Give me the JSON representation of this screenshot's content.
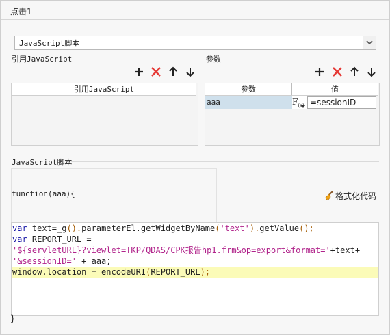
{
  "window": {
    "title": "点击1"
  },
  "script_type": {
    "selected": "JavaScript脚本"
  },
  "ref_js": {
    "group_label": "引用JavaScript",
    "column_header": "引用JavaScript"
  },
  "params": {
    "group_label": "参数",
    "col_name": "参数",
    "col_value": "值",
    "rows": [
      {
        "name": "aaa",
        "fx": "F",
        "fx_sub": "(x)",
        "value": "=sessionID"
      }
    ]
  },
  "script": {
    "group_label": "JavaScript脚本",
    "func_signature": "function(aaa){",
    "format_label": "格式化代码",
    "closing_brace": "}",
    "code": {
      "l1_kw": "var",
      "l1_a": " text=_g",
      "l1_b": "().",
      "l1_c": "parameterEl.getWidgetByName",
      "l1_d": "(",
      "l1_e": "'text'",
      "l1_f": ").",
      "l1_g": "getValue",
      "l1_h": "();",
      "l2_kw": "var",
      "l2_a": " REPORT_URL =",
      "l3_str": "'${servletURL}?viewlet=TKP/QDAS/CPK报告hp1.frm&op=export&format='",
      "l3_b": "+text+",
      "l4_str": "'&sessionID='",
      "l4_b": " + aaa;",
      "l5_a": "window.location = encodeURI",
      "l5_b": "(",
      "l5_c": "REPORT_URL",
      "l5_d": ");"
    }
  },
  "colors": {
    "highlight_line": "#fbfbb8",
    "selected_row": "#cfe0ec",
    "delete_icon": "#e53935"
  },
  "icons": [
    "add-icon",
    "delete-icon",
    "move-up-icon",
    "move-down-icon",
    "broom-icon",
    "chevron-down-icon"
  ]
}
